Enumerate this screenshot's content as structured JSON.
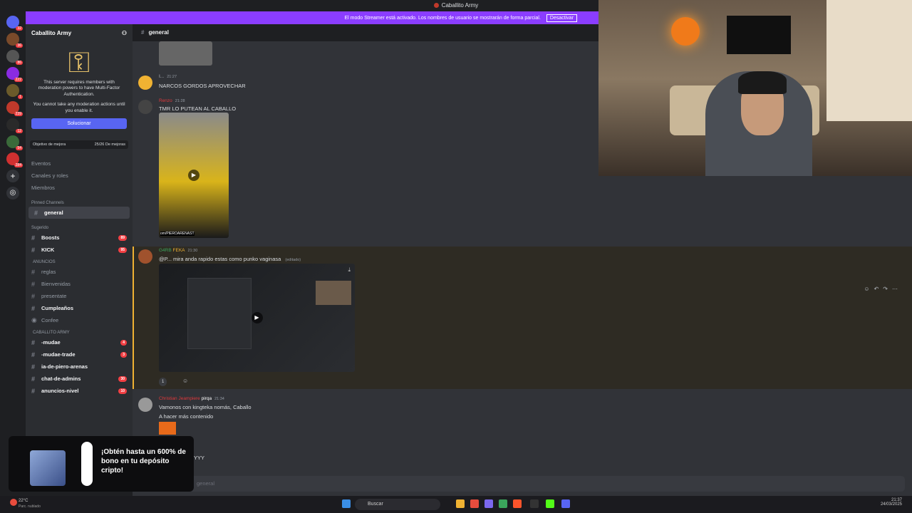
{
  "window": {
    "title": "Caballito Army"
  },
  "streamer_bar": {
    "text": "El modo Streamer está activado. Los nombres de usuario se mostrarán de forma parcial.",
    "button": "Desactivar"
  },
  "rail": {
    "badges": [
      "32",
      "36",
      "86",
      "222",
      "1",
      "239",
      "12",
      "54",
      "284"
    ]
  },
  "sidebar": {
    "server_name": "Caballito Army",
    "mfa_notice": "This server requires members with moderation powers to have Multi-Factor Authentication.",
    "mfa_warning": "You cannot take any moderation actions until you enable it.",
    "solve_button": "Solucionar",
    "goal_label": "Objetivo de mejora",
    "goal_value": "25/26 De mejoras",
    "menu": [
      "Eventos",
      "Canales y roles",
      "Miembros"
    ],
    "pinned_title": "Pinned Channels",
    "pinned_channel": "general",
    "suggested_title": "Sugerido",
    "suggested": [
      {
        "label": "Boosts",
        "count": "89"
      },
      {
        "label": "KICK",
        "count": "95"
      }
    ],
    "cat_announce": "ANUNCIOS",
    "announce_channels": [
      "reglas",
      "Bienvenidas",
      "presentate",
      "Cumpleaños",
      "Confee"
    ],
    "cat_caballito": "CABALLITO ARMY",
    "caballito_channels": [
      {
        "label": "-mudae",
        "count": "4"
      },
      {
        "label": "-mudae-trade",
        "count": "3"
      },
      {
        "label": "ia-de-piero-arenas",
        "count": ""
      },
      {
        "label": "chat-de-admins",
        "count": "30"
      },
      {
        "label": "anuncios-nivel",
        "count": "10"
      }
    ]
  },
  "channel_header": {
    "name": "general"
  },
  "messages": [
    {
      "user": "I...",
      "time": "21:27",
      "text": "NARCOS GORDOS APROVECHAR"
    },
    {
      "user": "Renzo",
      "time": "21:28",
      "text": "TMR LO PUTEAN AL CABALLO"
    },
    {
      "user": "G4RB",
      "tag": "FEKA",
      "time": "21:30",
      "text": "@P... mira anda rapido estas como punko vaginasa",
      "edited": "(editado)",
      "reaction": "1"
    },
    {
      "user": "Christian Jeampiere",
      "tag": "pirqa",
      "time": "21:34",
      "text1": "Vamonos con kingteka nomás, Caballo",
      "text2": "A hacer más contenido",
      "tail": "YYY"
    }
  ],
  "video_caption": "om/PIEROARENAST",
  "composer": {
    "placeholder": "general"
  },
  "ad": {
    "text": "¡Obtén hasta un 600% de bono en tu depósito cripto!"
  },
  "taskbar": {
    "weather": "22°C",
    "weather_desc": "Parc. nublado",
    "search": "Buscar",
    "time": "21:37",
    "date": "24/03/2025"
  },
  "colors": {
    "accent": "#5865f2",
    "streamer": "#8b3dff",
    "highlight": "#f0b232",
    "username_red": "#e0383b",
    "username_green": "#3ba55c"
  }
}
